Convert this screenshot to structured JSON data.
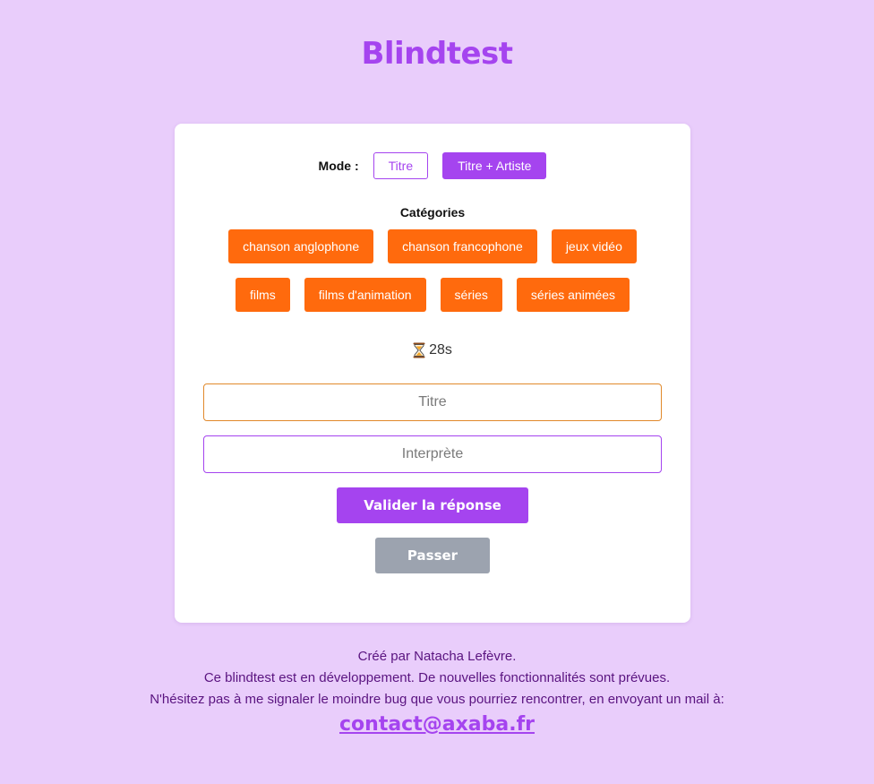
{
  "app": {
    "title": "Blindtest"
  },
  "mode": {
    "label": "Mode :",
    "options": [
      "Titre",
      "Titre + Artiste"
    ],
    "selected": "Titre + Artiste"
  },
  "categories": {
    "heading": "Catégories",
    "row1": [
      "chanson anglophone",
      "chanson francophone",
      "jeux vidéo"
    ],
    "row2": [
      "films",
      "films d'animation",
      "séries",
      "séries animées"
    ]
  },
  "timer": {
    "icon": "hourglass-icon",
    "value": "28s"
  },
  "form": {
    "title_placeholder": "Titre",
    "artist_placeholder": "Interprète",
    "submit_label": "Valider la réponse",
    "skip_label": "Passer"
  },
  "footer": {
    "line1": "Créé par Natacha Lefèvre.",
    "line2": "Ce blindtest est en développement. De nouvelles fonctionnalités sont prévues.",
    "line3": "N'hésitez pas à me signaler le moindre bug que vous pourriez rencontrer, en envoyant un mail à:",
    "email": "contact@axaba.fr"
  },
  "colors": {
    "background": "#e9cdfb",
    "accent": "#a544ef",
    "category": "#ff6a0d",
    "skip": "#9ca3af"
  }
}
